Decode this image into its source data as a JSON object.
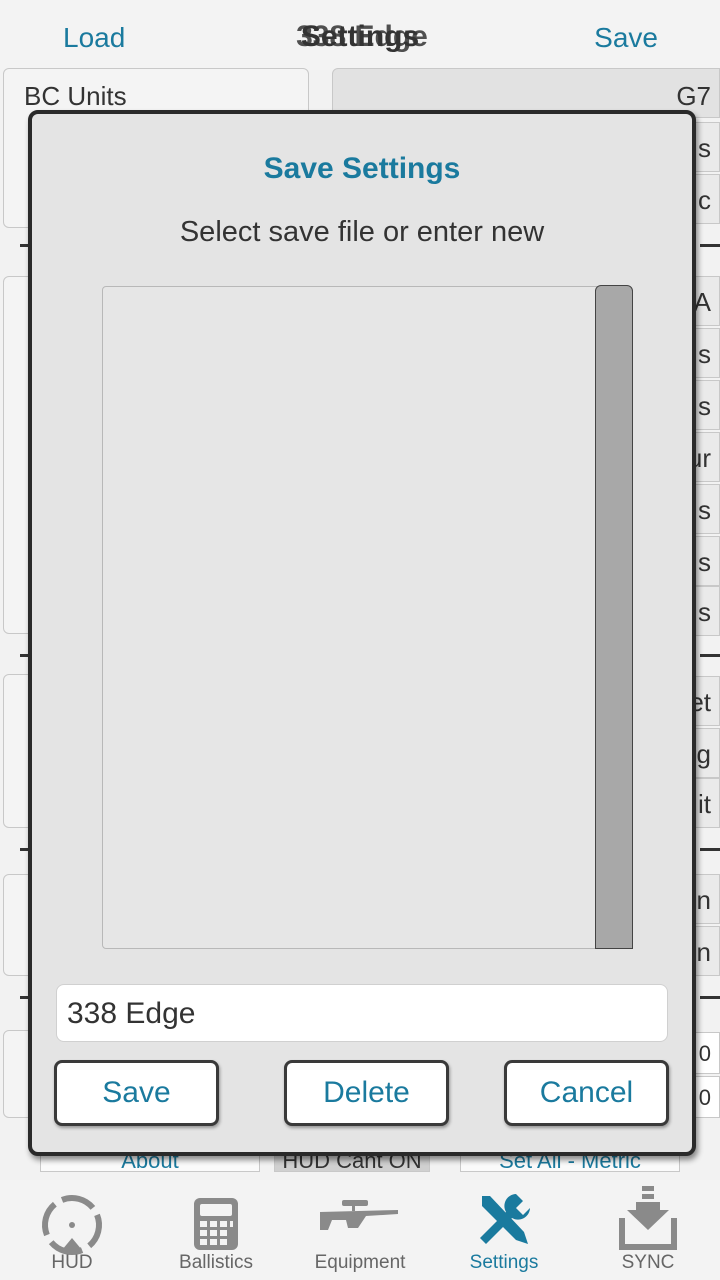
{
  "header": {
    "load_label": "Load",
    "title": "Settings",
    "title_ghost": "338 Edge",
    "save_label": "Save"
  },
  "background_rows": {
    "bc_units_label": "BC Units",
    "bc_units_value": "G7",
    "right_fragments": [
      "s",
      "c",
      "A",
      "s",
      "s",
      "ur",
      "s",
      "s",
      "s",
      "et",
      "g",
      "it",
      "n",
      "n",
      "0",
      "0"
    ],
    "bottom_buttons": [
      "About",
      "HUD Cant ON",
      "Set All - Metric"
    ]
  },
  "dialog": {
    "title": "Save Settings",
    "subtitle": "Select save file or enter new",
    "file_list": [],
    "filename_value": "338 Edge",
    "save_label": "Save",
    "delete_label": "Delete",
    "cancel_label": "Cancel"
  },
  "nav": {
    "items": [
      {
        "label": "HUD",
        "icon": "reticle-icon"
      },
      {
        "label": "Ballistics",
        "icon": "calculator-icon"
      },
      {
        "label": "Equipment",
        "icon": "rifle-icon"
      },
      {
        "label": "Settings",
        "icon": "wrench-screwdriver-icon"
      },
      {
        "label": "SYNC",
        "icon": "download-tray-icon"
      }
    ],
    "active": "Settings"
  },
  "colors": {
    "accent": "#1a7a9e",
    "background": "#f2f2f2",
    "dialog_bg": "#e4e4e4",
    "scrollbar": "#a8a8a8"
  }
}
